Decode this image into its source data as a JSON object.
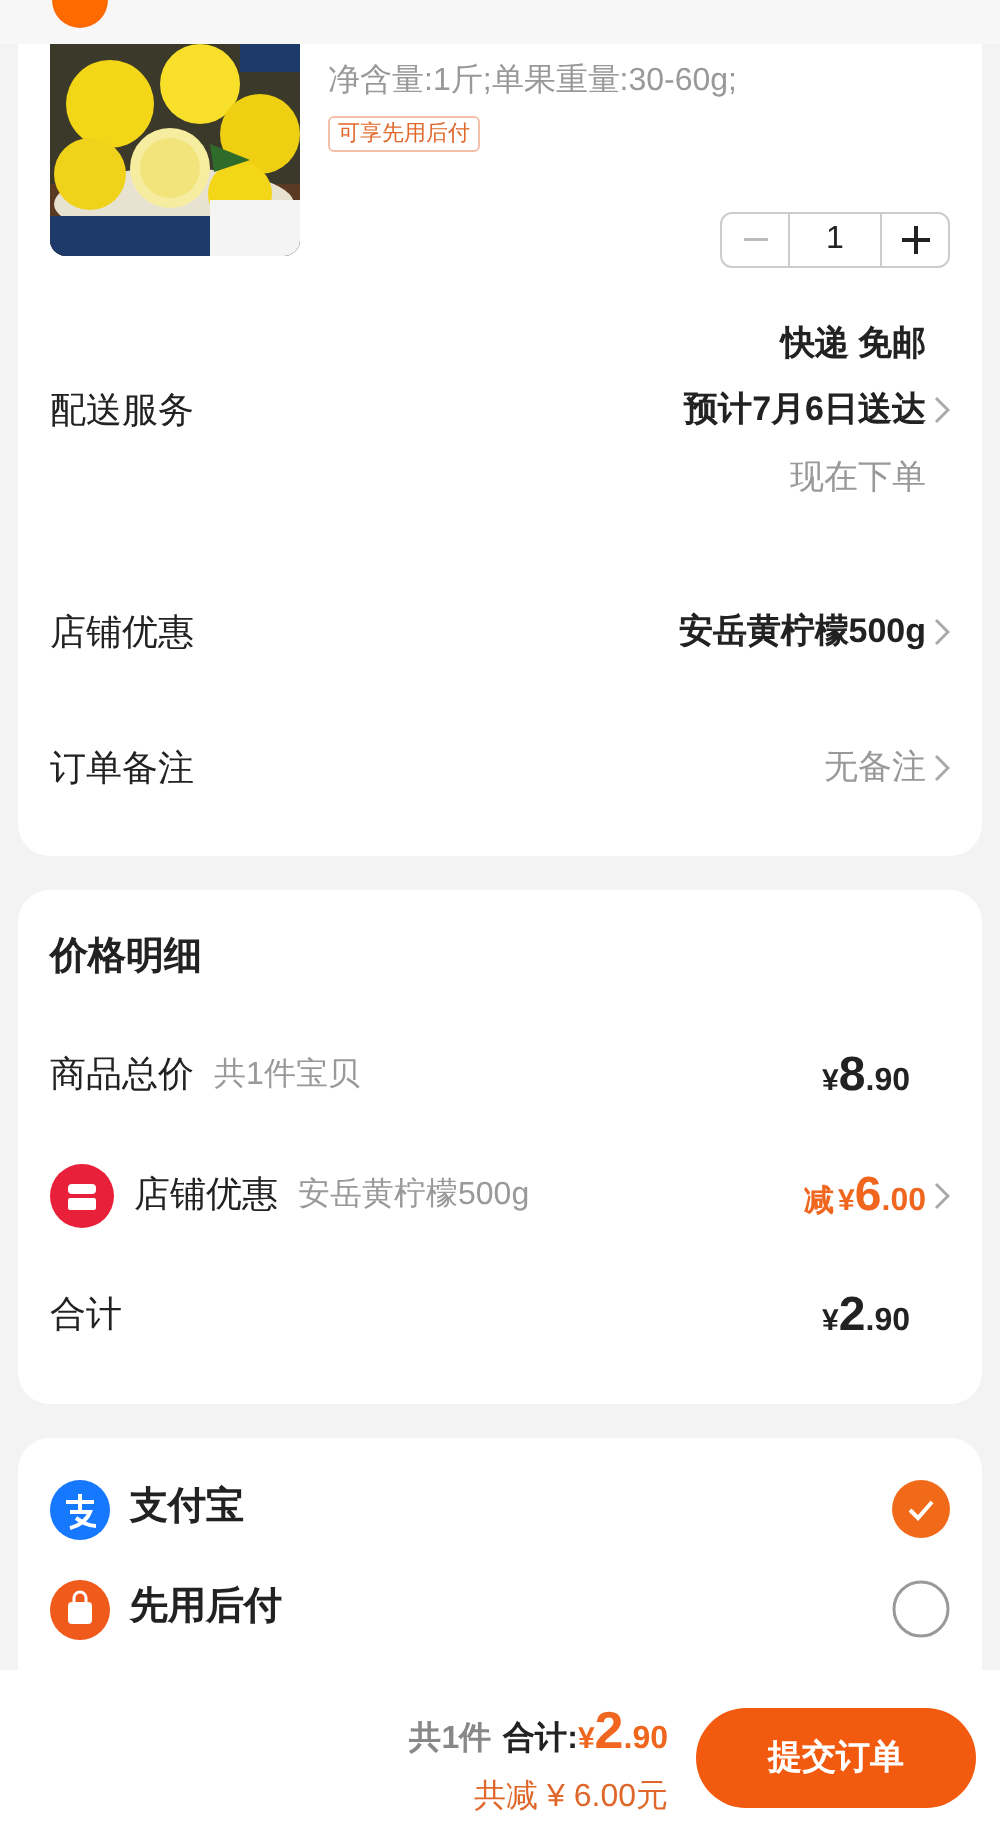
{
  "product": {
    "spec": "净含量:1斤;单果重量:30-60g;",
    "tag": "可享先用后付",
    "quantity": "1"
  },
  "order_rows": [
    {
      "label": "配送服务",
      "lines": [
        {
          "text": "快递 免邮",
          "kind": "strong"
        },
        {
          "text": "预计7月6日送达",
          "kind": "strong"
        },
        {
          "text": "现在下单",
          "kind": "muted"
        }
      ]
    },
    {
      "label": "店铺优惠",
      "lines": [
        {
          "text": "安岳黄柠檬500g",
          "kind": "strong"
        }
      ]
    },
    {
      "label": "订单备注",
      "lines": [
        {
          "text": "无备注",
          "kind": "muted"
        }
      ]
    }
  ],
  "price_detail": {
    "title": "价格明细",
    "rows": [
      {
        "kind": "plain",
        "label": "商品总价",
        "note": "共1件宝贝",
        "prefix": "",
        "currency": "¥",
        "int": "8",
        "dec": ".90"
      },
      {
        "kind": "discount",
        "label": "店铺优惠",
        "note": "安岳黄柠檬500g",
        "prefix": "减",
        "currency": "¥",
        "int": "6",
        "dec": ".00"
      },
      {
        "kind": "plain",
        "label": "合计",
        "note": "",
        "currency": "¥",
        "int": "2",
        "dec": ".90"
      }
    ]
  },
  "payment_methods": [
    {
      "kind": "alipay",
      "name": "支付宝",
      "selected": true
    },
    {
      "kind": "paylater",
      "name": "先用后付",
      "selected": false
    }
  ],
  "bottom_bar": {
    "count": "共1件",
    "total_label": "合计:",
    "currency": "¥",
    "int": "2",
    "dec": ".90",
    "saving": "共减 ¥ 6.00元",
    "submit": "提交订单"
  }
}
